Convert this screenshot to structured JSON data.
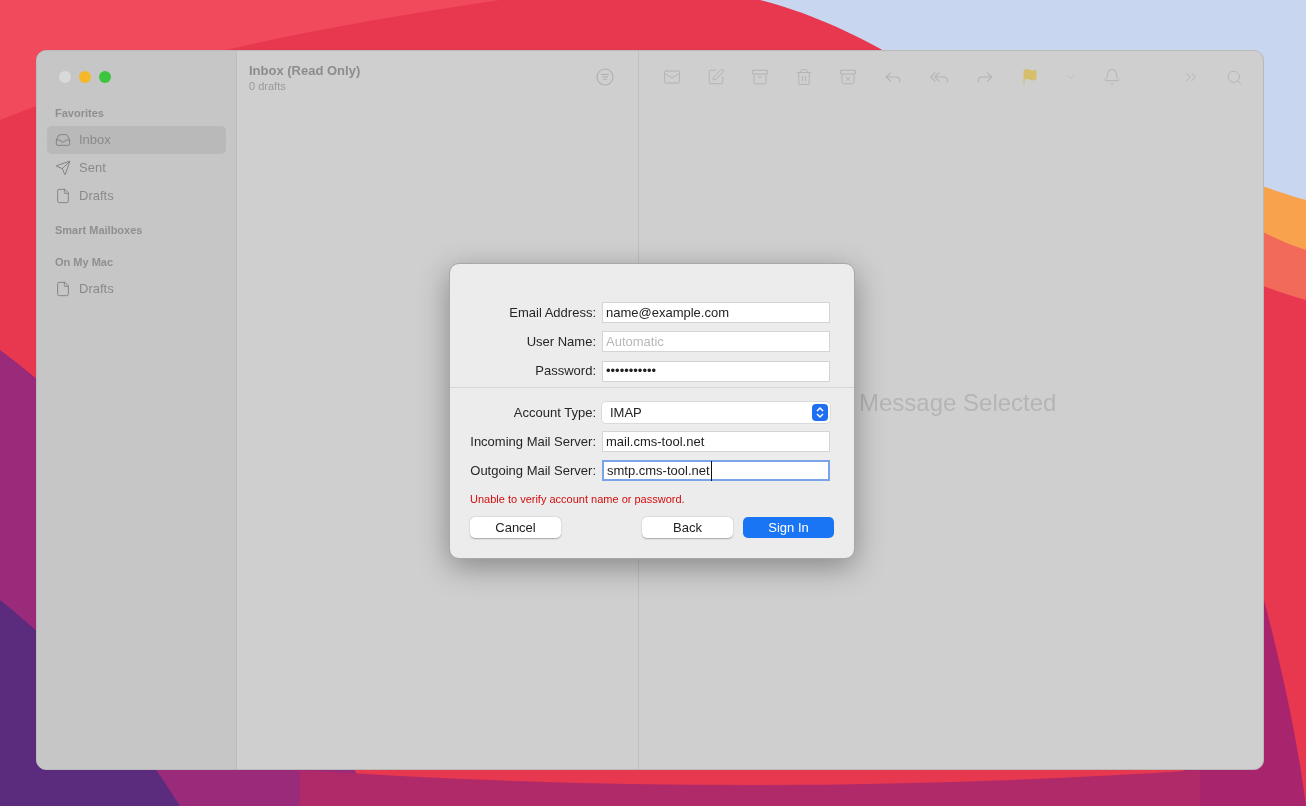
{
  "sidebar": {
    "sections": [
      {
        "title": "Favorites",
        "items": [
          {
            "label": "Inbox",
            "selected": true
          },
          {
            "label": "Sent",
            "selected": false
          },
          {
            "label": "Drafts",
            "selected": false
          }
        ]
      },
      {
        "title": "Smart Mailboxes"
      },
      {
        "title": "On My Mac",
        "items": [
          {
            "label": "Drafts",
            "selected": false
          }
        ]
      }
    ]
  },
  "message_list": {
    "title": "Inbox (Read Only)",
    "subtitle": "0 drafts"
  },
  "viewer": {
    "empty_text": "Message Selected"
  },
  "dialog": {
    "fields": [
      {
        "label": "Email Address:",
        "kind": "text",
        "value": "name@example.com",
        "focused": false
      },
      {
        "label": "User Name:",
        "kind": "text",
        "placeholder": "Automatic",
        "focused": false
      },
      {
        "label": "Password:",
        "kind": "text",
        "value": "•••••••••••",
        "focused": false
      },
      {
        "label": "Account Type:",
        "kind": "select",
        "value": "IMAP",
        "focused": false
      },
      {
        "label": "Incoming Mail Server:",
        "kind": "text",
        "value": "mail.cms-tool.net",
        "focused": false
      },
      {
        "label": "Outgoing Mail Server:",
        "kind": "text",
        "value": "smtp.cms-tool.net",
        "focused": true
      }
    ],
    "error": "Unable to verify account name or password.",
    "buttons": [
      {
        "label": "Cancel",
        "primary": false
      },
      {
        "label": "Back",
        "primary": false
      },
      {
        "label": "Sign In",
        "primary": true
      }
    ]
  }
}
